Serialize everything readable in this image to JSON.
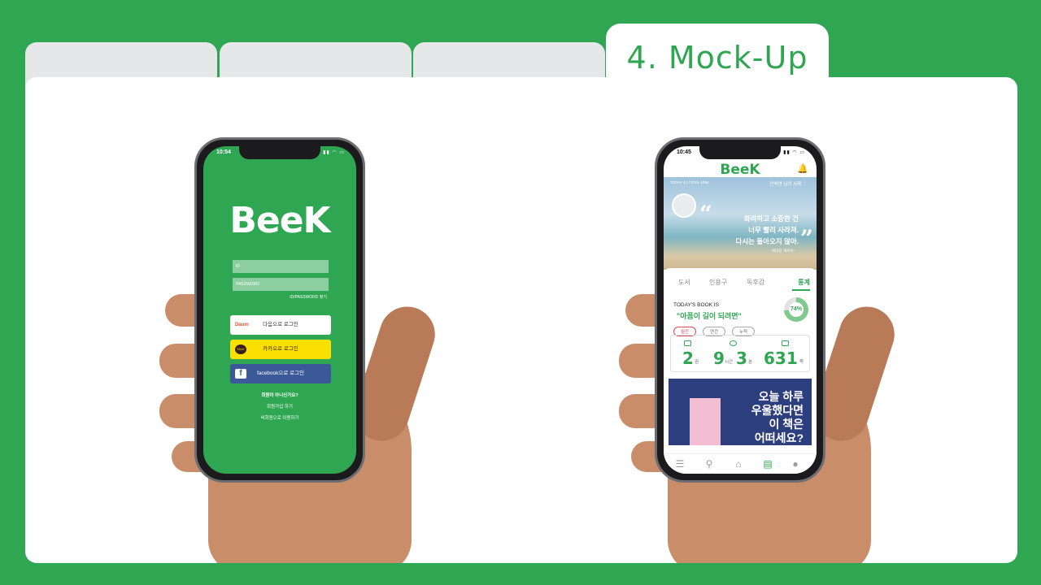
{
  "page": {
    "section_title": "4. Mock-Up"
  },
  "login_screen": {
    "status": {
      "time": "10:54",
      "icons": "▮▮ ◠ ▭"
    },
    "logo": "BeeK",
    "id_placeholder": "ID",
    "password_placeholder": "PASSWORD",
    "find_link": "ID/PASSWORD 찾기",
    "daum_icon": "Daum",
    "daum_label": "다음으로 로그인",
    "kakao_icon": "TALK",
    "kakao_label": "카카오로 로그인",
    "facebook_icon": "f",
    "facebook_label": "facebook으로 로그인",
    "not_member": "회원이 아니신가요?",
    "signup": "회원가입 하기",
    "guest": "비회원으로 이용하기"
  },
  "main_screen": {
    "status": {
      "time": "10:45",
      "icons": "▮▮ ◠ ▭"
    },
    "logo": "BeeK",
    "banner_stats": "TODAY 4 | TOTAL 1094",
    "banner_user": "안석영 님의 서재 ⋮",
    "quote_lines": [
      "화려하고 소중한 건",
      "너무 빨리 사라져.",
      "다시는 돌아오지 않아."
    ],
    "quote_source": "- 위대한 개츠비 -",
    "tabs": [
      "도서",
      "인용구",
      "독후감",
      "통계"
    ],
    "today_label": "TODAY'S BOOK IS",
    "today_title": "\"아픔이 길이 되려면\"",
    "progress_percent": 74,
    "progress_label": "74%",
    "periods": [
      "월간",
      "연간",
      "누적"
    ],
    "stats": {
      "books_value": "2",
      "books_unit": "권",
      "hours_value": "9",
      "hours_unit": "시간",
      "minutes_value": "3",
      "minutes_unit": "분",
      "pages_value": "631",
      "pages_unit": "쪽"
    },
    "ad_lines": [
      "오늘 하루",
      "우울했다면",
      "이 책은",
      "어떠세요?"
    ],
    "bottom_nav": [
      "menu-icon",
      "search-icon",
      "home-icon",
      "library-icon",
      "profile-icon"
    ]
  },
  "colors": {
    "brand_green": "#2fa652",
    "kakao_yellow": "#f9e000",
    "facebook_blue": "#3b5998"
  }
}
